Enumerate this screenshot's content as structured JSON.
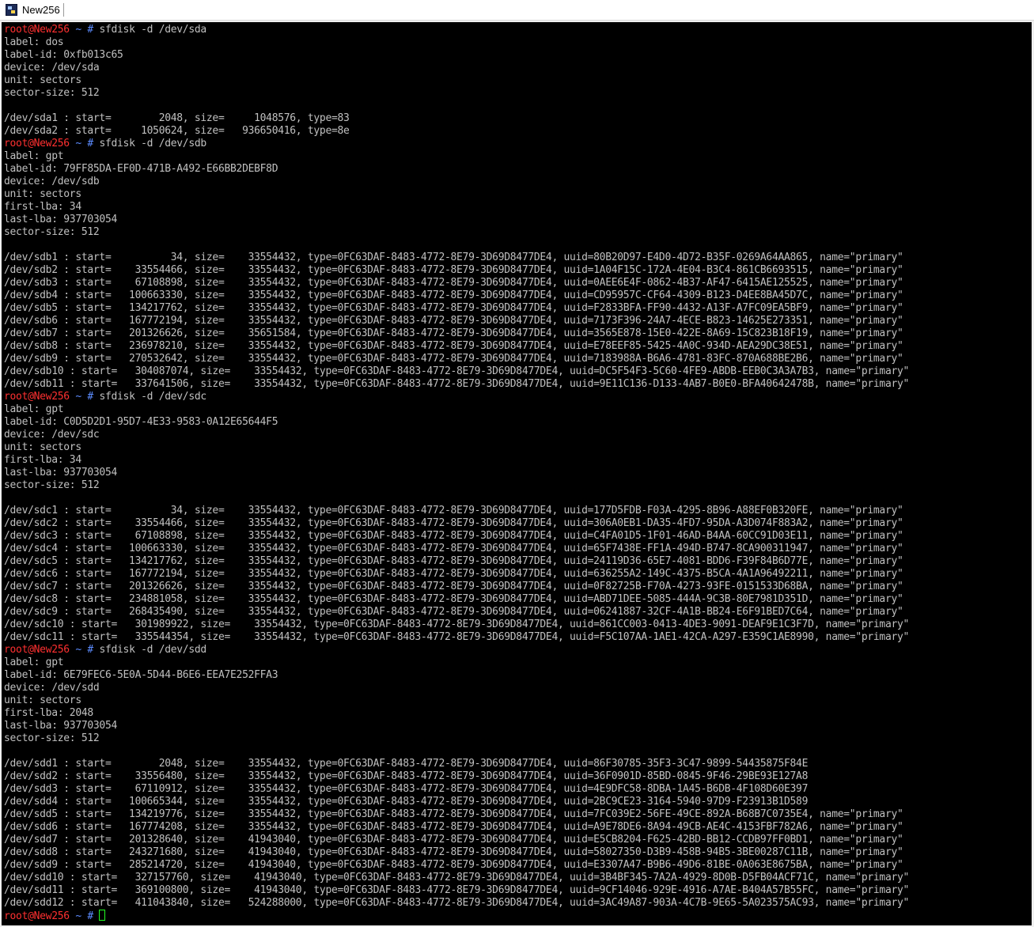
{
  "window": {
    "title": "New256"
  },
  "colors": {
    "prompt_user": "#ff3030",
    "prompt_path": "#5c8cff",
    "text": "#c0c0c0",
    "background": "#000000",
    "cursor": "#22ff22"
  },
  "prompt": {
    "user": "root",
    "host": "@New256",
    "path": " ~ # "
  },
  "lines": [
    {
      "type": "cmd",
      "text": "sfdisk -d /dev/sda"
    },
    {
      "type": "out",
      "text": "label: dos"
    },
    {
      "type": "out",
      "text": "label-id: 0xfb013c65"
    },
    {
      "type": "out",
      "text": "device: /dev/sda"
    },
    {
      "type": "out",
      "text": "unit: sectors"
    },
    {
      "type": "out",
      "text": "sector-size: 512"
    },
    {
      "type": "out",
      "text": ""
    },
    {
      "type": "out",
      "text": "/dev/sda1 : start=        2048, size=     1048576, type=83"
    },
    {
      "type": "out",
      "text": "/dev/sda2 : start=     1050624, size=   936650416, type=8e"
    },
    {
      "type": "cmd",
      "text": "sfdisk -d /dev/sdb"
    },
    {
      "type": "out",
      "text": "label: gpt"
    },
    {
      "type": "out",
      "text": "label-id: 79FF85DA-EF0D-471B-A492-E66BB2DEBF8D"
    },
    {
      "type": "out",
      "text": "device: /dev/sdb"
    },
    {
      "type": "out",
      "text": "unit: sectors"
    },
    {
      "type": "out",
      "text": "first-lba: 34"
    },
    {
      "type": "out",
      "text": "last-lba: 937703054"
    },
    {
      "type": "out",
      "text": "sector-size: 512"
    },
    {
      "type": "out",
      "text": ""
    },
    {
      "type": "out",
      "text": "/dev/sdb1 : start=          34, size=    33554432, type=0FC63DAF-8483-4772-8E79-3D69D8477DE4, uuid=80B20D97-E4D0-4D72-B35F-0269A64AA865, name=\"primary\""
    },
    {
      "type": "out",
      "text": "/dev/sdb2 : start=    33554466, size=    33554432, type=0FC63DAF-8483-4772-8E79-3D69D8477DE4, uuid=1A04F15C-172A-4E04-B3C4-861CB6693515, name=\"primary\""
    },
    {
      "type": "out",
      "text": "/dev/sdb3 : start=    67108898, size=    33554432, type=0FC63DAF-8483-4772-8E79-3D69D8477DE4, uuid=0AEE6E4F-0862-4B37-AF47-6415AE125525, name=\"primary\""
    },
    {
      "type": "out",
      "text": "/dev/sdb4 : start=   100663330, size=    33554432, type=0FC63DAF-8483-4772-8E79-3D69D8477DE4, uuid=CD95957C-CF64-4309-B123-D4EE8BA45D7C, name=\"primary\""
    },
    {
      "type": "out",
      "text": "/dev/sdb5 : start=   134217762, size=    33554432, type=0FC63DAF-8483-4772-8E79-3D69D8477DE4, uuid=F2833BFA-FF90-4432-A13F-A7FC09EA5BF9, name=\"primary\""
    },
    {
      "type": "out",
      "text": "/dev/sdb6 : start=   167772194, size=    33554432, type=0FC63DAF-8483-4772-8E79-3D69D8477DE4, uuid=7173F396-24A7-4ECE-B823-14625E273351, name=\"primary\""
    },
    {
      "type": "out",
      "text": "/dev/sdb7 : start=   201326626, size=    35651584, type=0FC63DAF-8483-4772-8E79-3D69D8477DE4, uuid=3565E878-15E0-422E-8A69-15C823B18F19, name=\"primary\""
    },
    {
      "type": "out",
      "text": "/dev/sdb8 : start=   236978210, size=    33554432, type=0FC63DAF-8483-4772-8E79-3D69D8477DE4, uuid=E78EEF85-5425-4A0C-934D-AEA29DC38E51, name=\"primary\""
    },
    {
      "type": "out",
      "text": "/dev/sdb9 : start=   270532642, size=    33554432, type=0FC63DAF-8483-4772-8E79-3D69D8477DE4, uuid=7183988A-B6A6-4781-83FC-870A688BE2B6, name=\"primary\""
    },
    {
      "type": "out",
      "text": "/dev/sdb10 : start=   304087074, size=    33554432, type=0FC63DAF-8483-4772-8E79-3D69D8477DE4, uuid=DC5F54F3-5C60-4FE9-ABDB-EEB0C3A3A7B3, name=\"primary\""
    },
    {
      "type": "out",
      "text": "/dev/sdb11 : start=   337641506, size=    33554432, type=0FC63DAF-8483-4772-8E79-3D69D8477DE4, uuid=9E11C136-D133-4AB7-B0E0-BFA40642478B, name=\"primary\""
    },
    {
      "type": "cmd",
      "text": "sfdisk -d /dev/sdc"
    },
    {
      "type": "out",
      "text": "label: gpt"
    },
    {
      "type": "out",
      "text": "label-id: C0D5D2D1-95D7-4E33-9583-0A12E65644F5"
    },
    {
      "type": "out",
      "text": "device: /dev/sdc"
    },
    {
      "type": "out",
      "text": "unit: sectors"
    },
    {
      "type": "out",
      "text": "first-lba: 34"
    },
    {
      "type": "out",
      "text": "last-lba: 937703054"
    },
    {
      "type": "out",
      "text": "sector-size: 512"
    },
    {
      "type": "out",
      "text": ""
    },
    {
      "type": "out",
      "text": "/dev/sdc1 : start=          34, size=    33554432, type=0FC63DAF-8483-4772-8E79-3D69D8477DE4, uuid=177D5FDB-F03A-4295-8B96-A88EF0B320FE, name=\"primary\""
    },
    {
      "type": "out",
      "text": "/dev/sdc2 : start=    33554466, size=    33554432, type=0FC63DAF-8483-4772-8E79-3D69D8477DE4, uuid=306A0EB1-DA35-4FD7-95DA-A3D074F883A2, name=\"primary\""
    },
    {
      "type": "out",
      "text": "/dev/sdc3 : start=    67108898, size=    33554432, type=0FC63DAF-8483-4772-8E79-3D69D8477DE4, uuid=C4FA01D5-1F01-46AD-B4AA-60CC91D03E11, name=\"primary\""
    },
    {
      "type": "out",
      "text": "/dev/sdc4 : start=   100663330, size=    33554432, type=0FC63DAF-8483-4772-8E79-3D69D8477DE4, uuid=65F7438E-FF1A-494D-B747-8CA900311947, name=\"primary\""
    },
    {
      "type": "out",
      "text": "/dev/sdc5 : start=   134217762, size=    33554432, type=0FC63DAF-8483-4772-8E79-3D69D8477DE4, uuid=24119D36-65E7-4081-BDD6-F39F84B6D77E, name=\"primary\""
    },
    {
      "type": "out",
      "text": "/dev/sdc6 : start=   167772194, size=    33554432, type=0FC63DAF-8483-4772-8E79-3D69D8477DE4, uuid=636255A2-149C-4375-B5CA-4A1A96492211, name=\"primary\""
    },
    {
      "type": "out",
      "text": "/dev/sdc7 : start=   201326626, size=    33554432, type=0FC63DAF-8483-4772-8E79-3D69D8477DE4, uuid=0F82725B-F70A-4273-93FE-0151533D68BA, name=\"primary\""
    },
    {
      "type": "out",
      "text": "/dev/sdc8 : start=   234881058, size=    33554432, type=0FC63DAF-8483-4772-8E79-3D69D8477DE4, uuid=ABD71DEE-5085-444A-9C3B-80E7981D351D, name=\"primary\""
    },
    {
      "type": "out",
      "text": "/dev/sdc9 : start=   268435490, size=    33554432, type=0FC63DAF-8483-4772-8E79-3D69D8477DE4, uuid=06241887-32CF-4A1B-BB24-E6F91BED7C64, name=\"primary\""
    },
    {
      "type": "out",
      "text": "/dev/sdc10 : start=   301989922, size=    33554432, type=0FC63DAF-8483-4772-8E79-3D69D8477DE4, uuid=861CC003-0413-4DE3-9091-DEAF9E1C3F7D, name=\"primary\""
    },
    {
      "type": "out",
      "text": "/dev/sdc11 : start=   335544354, size=    33554432, type=0FC63DAF-8483-4772-8E79-3D69D8477DE4, uuid=F5C107AA-1AE1-42CA-A297-E359C1AE8990, name=\"primary\""
    },
    {
      "type": "cmd",
      "text": "sfdisk -d /dev/sdd"
    },
    {
      "type": "out",
      "text": "label: gpt"
    },
    {
      "type": "out",
      "text": "label-id: 6E79FEC6-5E0A-5D44-B6E6-EEA7E252FFA3"
    },
    {
      "type": "out",
      "text": "device: /dev/sdd"
    },
    {
      "type": "out",
      "text": "unit: sectors"
    },
    {
      "type": "out",
      "text": "first-lba: 2048"
    },
    {
      "type": "out",
      "text": "last-lba: 937703054"
    },
    {
      "type": "out",
      "text": "sector-size: 512"
    },
    {
      "type": "out",
      "text": ""
    },
    {
      "type": "out",
      "text": "/dev/sdd1 : start=        2048, size=    33554432, type=0FC63DAF-8483-4772-8E79-3D69D8477DE4, uuid=86F30785-35F3-3C47-9899-54435875F84E"
    },
    {
      "type": "out",
      "text": "/dev/sdd2 : start=    33556480, size=    33554432, type=0FC63DAF-8483-4772-8E79-3D69D8477DE4, uuid=36F0901D-85BD-0845-9F46-29BE93E127A8"
    },
    {
      "type": "out",
      "text": "/dev/sdd3 : start=    67110912, size=    33554432, type=0FC63DAF-8483-4772-8E79-3D69D8477DE4, uuid=4E9DFC58-8DBA-1A45-B6DB-4F108D60E397"
    },
    {
      "type": "out",
      "text": "/dev/sdd4 : start=   100665344, size=    33554432, type=0FC63DAF-8483-4772-8E79-3D69D8477DE4, uuid=2BC9CE23-3164-5940-97D9-F23913B1D589"
    },
    {
      "type": "out",
      "text": "/dev/sdd5 : start=   134219776, size=    33554432, type=0FC63DAF-8483-4772-8E79-3D69D8477DE4, uuid=7FC039E2-56FE-49CE-892A-B68B7C0735E4, name=\"primary\""
    },
    {
      "type": "out",
      "text": "/dev/sdd6 : start=   167774208, size=    33554432, type=0FC63DAF-8483-4772-8E79-3D69D8477DE4, uuid=A9E78DE6-8A94-49CB-AE4C-4153FBF782A6, name=\"primary\""
    },
    {
      "type": "out",
      "text": "/dev/sdd7 : start=   201328640, size=    41943040, type=0FC63DAF-8483-4772-8E79-3D69D8477DE4, uuid=E5CB8204-F625-42BD-BB12-CCDB97FF0BD1, name=\"primary\""
    },
    {
      "type": "out",
      "text": "/dev/sdd8 : start=   243271680, size=    41943040, type=0FC63DAF-8483-4772-8E79-3D69D8477DE4, uuid=58027350-D3B9-458B-94B5-3BE00287C11B, name=\"primary\""
    },
    {
      "type": "out",
      "text": "/dev/sdd9 : start=   285214720, size=    41943040, type=0FC63DAF-8483-4772-8E79-3D69D8477DE4, uuid=E3307A47-B9B6-49D6-81BE-0A063E8675BA, name=\"primary\""
    },
    {
      "type": "out",
      "text": "/dev/sdd10 : start=   327157760, size=    41943040, type=0FC63DAF-8483-4772-8E79-3D69D8477DE4, uuid=3B4BF345-7A2A-4929-8D0B-D5FB04ACF71C, name=\"primary\""
    },
    {
      "type": "out",
      "text": "/dev/sdd11 : start=   369100800, size=    41943040, type=0FC63DAF-8483-4772-8E79-3D69D8477DE4, uuid=9CF14046-929E-4916-A7AE-B404A57B55FC, name=\"primary\""
    },
    {
      "type": "out",
      "text": "/dev/sdd12 : start=   411043840, size=   524288000, type=0FC63DAF-8483-4772-8E79-3D69D8477DE4, uuid=3AC49A87-903A-4C7B-9E65-5A023575AC93, name=\"primary\""
    },
    {
      "type": "cmd",
      "text": ""
    }
  ]
}
